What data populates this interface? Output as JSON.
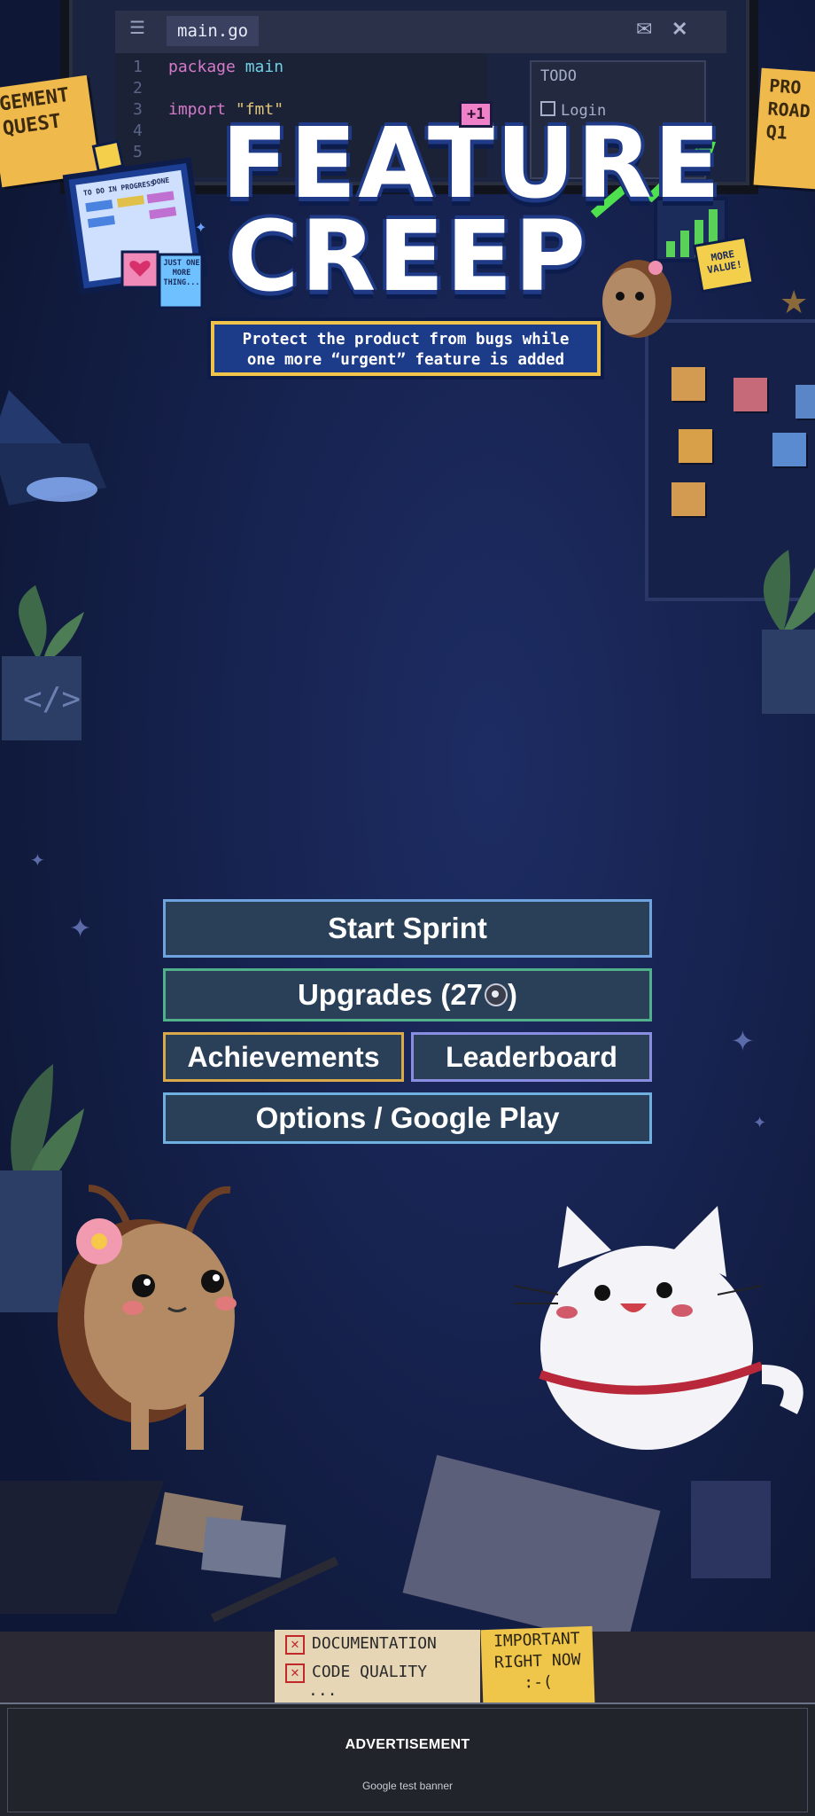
{
  "editor": {
    "tab_label": "main.go",
    "code_lines": [
      {
        "n": "1",
        "text": "package main"
      },
      {
        "n": "2",
        "text": ""
      },
      {
        "n": "3",
        "text": "import \"fmt\""
      },
      {
        "n": "4",
        "text": ""
      },
      {
        "n": "5",
        "text": ""
      }
    ],
    "todo_title": "TODO",
    "todo_item": "Login"
  },
  "sticky_notes": {
    "left": "GEMENT\nQUEST",
    "right": "PRO\nROAD\nQ1"
  },
  "logo": {
    "line1": "FEATURE",
    "line2": "CREEP",
    "tagline_1": "Protect the product from bugs while",
    "tagline_2": "one more “urgent” feature is added",
    "badge_plus_one": "+1",
    "kanban_cols": [
      "TO DO",
      "IN PROGRESS",
      "DONE"
    ],
    "note_just_one": "JUST ONE MORE THING...",
    "note_more_value": "MORE VALUE!"
  },
  "menu": {
    "start": "Start Sprint",
    "upgrades_prefix": "Upgrades (27",
    "upgrades_suffix": ")",
    "achievements": "Achievements",
    "leaderboard": "Leaderboard",
    "options": "Options / Google Play"
  },
  "desk_notes": {
    "doc_1": "DOCUMENTATION",
    "doc_2": "CODE QUALITY",
    "doc_3": "...",
    "important_1": "IMPORTANT",
    "important_2": "RIGHT NOW",
    "important_3": ":-("
  },
  "ad": {
    "title": "ADVERTISEMENT",
    "subtitle": "Google test banner"
  },
  "colors": {
    "background": "#16224e",
    "button_fill": "#2a4059",
    "start_border": "#6fa3e0",
    "upgrades_border": "#4fb08a",
    "achievements_border": "#d9a94a",
    "leaderboard_border": "#8a8ee0",
    "options_border": "#6fb0e0"
  }
}
